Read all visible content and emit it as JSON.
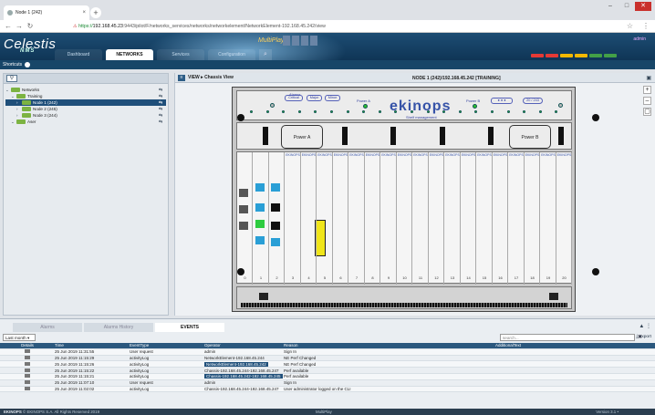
{
  "browser": {
    "tab_title": "Node 1 (242)",
    "url_prefix": "https://",
    "url_host": "192.168.45.23",
    "url_rest": ":9443/pilot/F/networks_services/networks/networkelement/NetworkElement-192.168.45.242/view",
    "close_label": "×"
  },
  "app": {
    "logo": "Celestis",
    "logo_sub": "NMS",
    "multiplay": "MultiPlay",
    "user": "admin",
    "nav_tabs": [
      "Dashboard",
      "NETWORKS",
      "Services",
      "Configuration"
    ],
    "active_tab": "NETWORKS",
    "alarm_colors": [
      "#e53935",
      "#e53935",
      "#f5b800",
      "#f5b800",
      "#43a047",
      "#43a047"
    ],
    "shortcuts_label": "Shortcuts"
  },
  "tree": {
    "items": [
      {
        "label": "Networks",
        "indent": 0,
        "chev": "⌄"
      },
      {
        "label": "Training",
        "indent": 1,
        "chev": "⌄"
      },
      {
        "label": "Node 1 (242)",
        "indent": 2,
        "chev": "›",
        "selected": true
      },
      {
        "label": "Node 2 (245)",
        "indent": 2,
        "chev": "›"
      },
      {
        "label": "Node 3 (244)",
        "indent": 2,
        "chev": "›"
      },
      {
        "label": "Aser",
        "indent": 1,
        "chev": "⌄"
      }
    ]
  },
  "view": {
    "breadcrumb": "VIEW ▸ Chassis View",
    "node_title": "NODE 1 (242)/192.168.45.242 [TRAINING]"
  },
  "chassis": {
    "brand": "ekinops",
    "power_a": "Power A",
    "power_b": "Power B",
    "fan_labels": [
      "Critical",
      "Major",
      "Minor"
    ],
    "alarm_label": "Alarms",
    "management_label": "Shelf management",
    "psu_a": "Power A",
    "psu_b": "Power B",
    "slot_label": "EKINOPS",
    "slot_numbers": [
      "0",
      "1",
      "2",
      "3",
      "4",
      "5",
      "6",
      "7",
      "8",
      "9",
      "10",
      "11",
      "12",
      "13",
      "14",
      "15",
      "16",
      "17",
      "18",
      "19",
      "20"
    ]
  },
  "events": {
    "tabs": [
      "Alarms",
      "Alarms History",
      "EVENTS"
    ],
    "active_tab": "EVENTS",
    "filter": "Last month",
    "search_placeholder": "search...",
    "export_label": "export",
    "columns": [
      "Details",
      "Time",
      "EventType",
      "Operator",
      "Reason",
      "AdditionalText"
    ],
    "rows": [
      {
        "time": "25 Jun 2019 11:31:55",
        "type": "User request",
        "op": "admin",
        "reason": "Sign In",
        "hl": false
      },
      {
        "time": "25 Jun 2019 11:15:29",
        "type": "activityLog",
        "op": "NetworkElement-192.168.45.244",
        "reason": "NE Perf Changed",
        "hl": false
      },
      {
        "time": "25 Jun 2019 11:15:26",
        "type": "activityLog",
        "op": "NetworkElement-192.168.45.242",
        "reason": "NE Perf Changed",
        "hl": true
      },
      {
        "time": "25 Jun 2019 11:15:22",
        "type": "activityLog",
        "op": "Chassis-192.168.45.244-192.168.45.247",
        "reason": "Perf available",
        "hl": false
      },
      {
        "time": "25 Jun 2019 11:15:21",
        "type": "activityLog",
        "op": "Chassis-192.168.45.242-192.168.45.245",
        "reason": "Perf available",
        "hl": true
      },
      {
        "time": "25 Jun 2019 11:07:10",
        "type": "User request",
        "op": "admin",
        "reason": "Sign In",
        "hl": false
      },
      {
        "time": "25 Jun 2019 11:02:02",
        "type": "activityLog",
        "op": "Chassis-192.168.45.244-192.168.45.247",
        "reason": "User administrator logged on the CLI",
        "hl": false
      }
    ]
  },
  "footer": {
    "brand": "EKINOPS",
    "copyright": "© EKINOPS S.A. All Rights Reserved 2019",
    "status": "MultiPlay",
    "version": "Version 3.1 •"
  }
}
